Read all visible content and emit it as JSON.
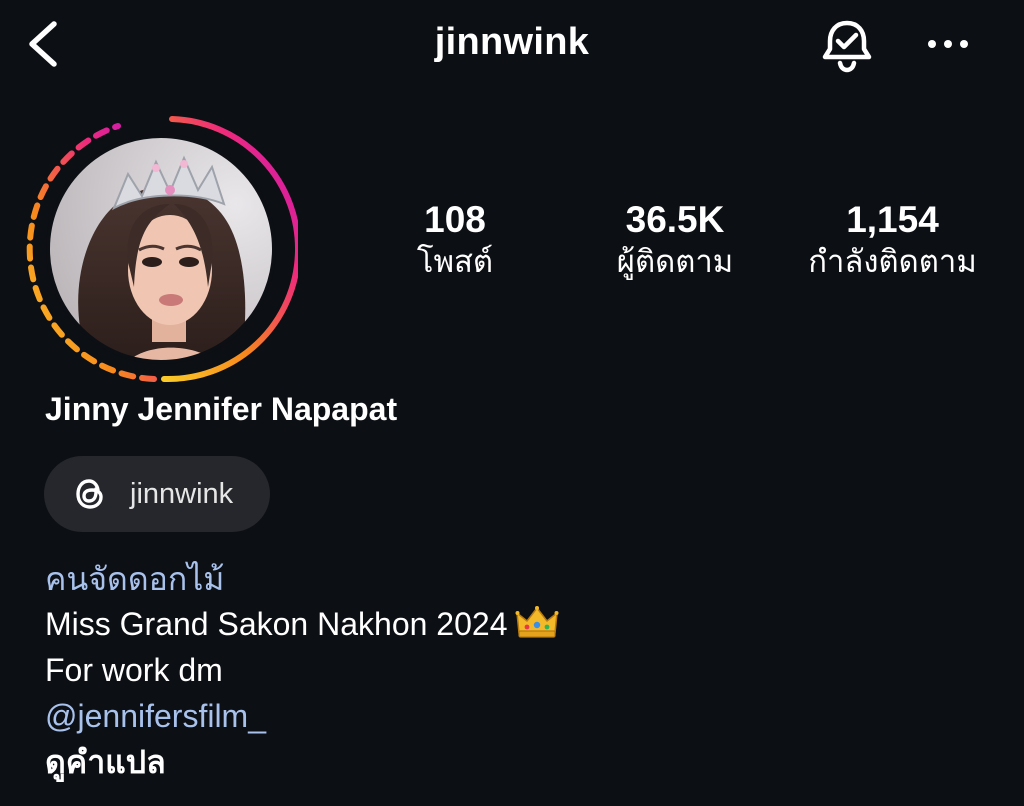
{
  "header": {
    "username": "jinnwink"
  },
  "icons": {
    "back": "chevron-left-icon",
    "bell": "bell-check-icon",
    "more": "more-horizontal-icon",
    "threads": "threads-icon",
    "crown": "crown-emoji"
  },
  "profile": {
    "display_name": "Jinny Jennifer Napapat",
    "story_ring_colors": [
      "#fbcb29",
      "#f7891d",
      "#ee2a7b",
      "#c013c7"
    ]
  },
  "stats": [
    {
      "value": "108",
      "label": "โพสต์"
    },
    {
      "value": "36.5K",
      "label": "ผู้ติดตาม"
    },
    {
      "value": "1,154",
      "label": "กำลังติดตาม"
    }
  ],
  "threads_badge": {
    "label": "jinnwink"
  },
  "bio": {
    "category": "คนจัดดอกไม้",
    "line1": "Miss Grand Sakon Nakhon 2024",
    "line2": "For work dm",
    "mention": "@jennifersfilm_",
    "translate": "ดูคำแปล"
  },
  "colors": {
    "background": "#0c0f14",
    "link": "#a9c2ec",
    "pill": "#25272c"
  }
}
